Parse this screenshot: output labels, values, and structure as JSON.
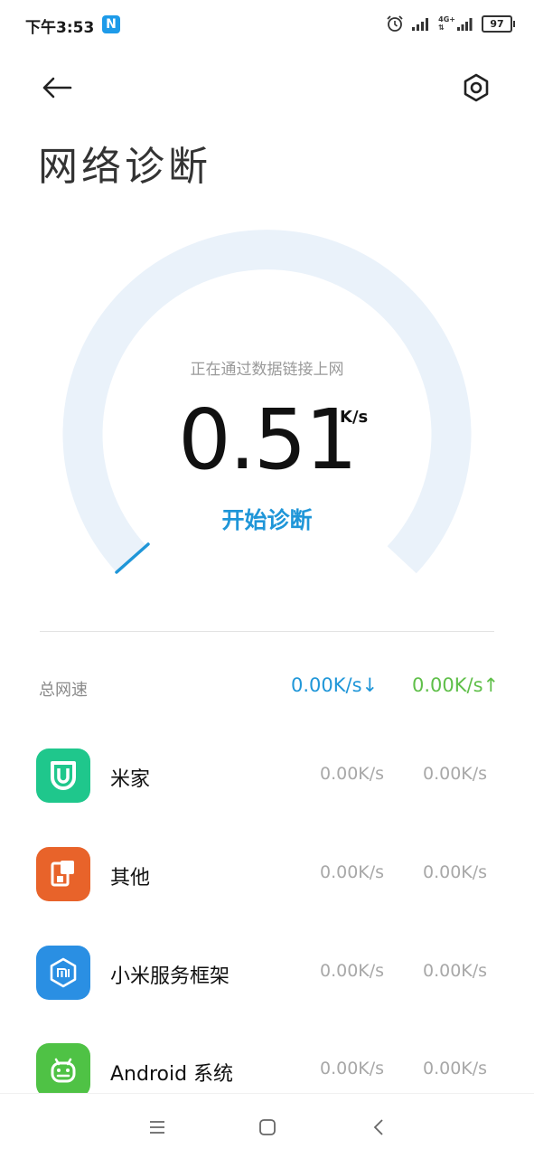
{
  "status_bar": {
    "time": "下午3:53",
    "notification_badge": "N",
    "alarm_icon": "alarm-icon",
    "signal_icon": "signal-icon",
    "network_type_top": "4G+",
    "network_type_bottom": "⇅",
    "battery": "97"
  },
  "header": {
    "back_icon": "back-arrow-icon",
    "settings_icon": "settings-hexagon-icon",
    "title": "网络诊断"
  },
  "gauge": {
    "status_text": "正在通过数据链接上网",
    "speed_value": "0.51",
    "speed_unit": "K/s",
    "start_button": "开始诊断",
    "track_color": "#eaf2fa",
    "accent_color": "#1f96d8"
  },
  "total": {
    "label": "总网速",
    "download": "0.00K/s↓",
    "upload": "0.00K/s↑",
    "download_color": "#1f96d8",
    "upload_color": "#5fbf49"
  },
  "apps": [
    {
      "name": "米家",
      "download": "0.00K/s",
      "upload": "0.00K/s",
      "icon": "mijia-icon",
      "icon_color": "#1fc78c"
    },
    {
      "name": "其他",
      "download": "0.00K/s",
      "upload": "0.00K/s",
      "icon": "other-apps-icon",
      "icon_color": "#e8632a"
    },
    {
      "name": "小米服务框架",
      "download": "0.00K/s",
      "upload": "0.00K/s",
      "icon": "mi-service-icon",
      "icon_color": "#2a8fe3"
    },
    {
      "name": "Android 系统",
      "download": "0.00K/s",
      "upload": "0.00K/s",
      "icon": "android-icon",
      "icon_color": "#4fc245"
    }
  ],
  "nav_bar": {
    "menu_icon": "menu-icon",
    "home_icon": "home-icon",
    "back_icon": "nav-back-icon"
  }
}
